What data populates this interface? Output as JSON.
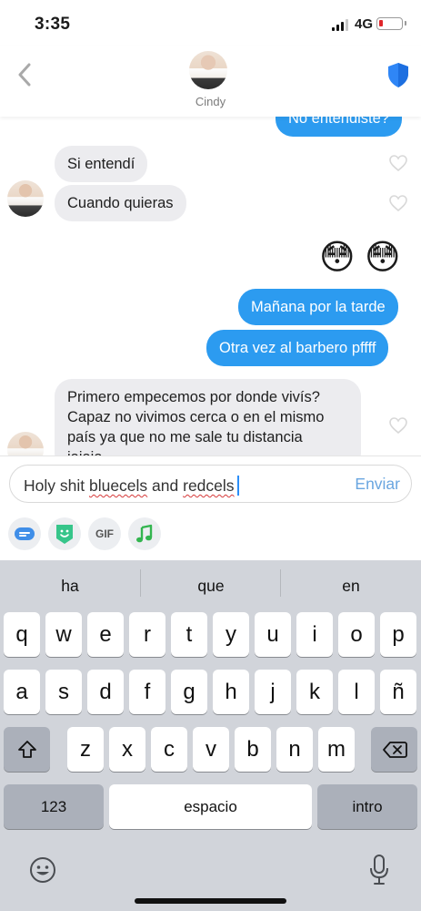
{
  "status": {
    "time": "3:35",
    "network": "4G"
  },
  "header": {
    "contact_name": "Cindy"
  },
  "messages": {
    "out_top_partial": "No entendiste?",
    "in_1": "Si entendí",
    "in_2": "Cuando quieras",
    "emoji_1": "😳",
    "emoji_2": "😳",
    "out_1": "Mañana por la tarde",
    "out_2": "Otra vez al barbero pffff",
    "in_3_line1": "Primero empecemos por donde vivís?",
    "in_3_line2": "Capaz no vivimos cerca o en el mismo",
    "in_3_line3": "país ya que no me sale tu distancia",
    "in_3_line4": "jajaja"
  },
  "composer": {
    "text_1": "Holy shit ",
    "text_2": "bluecels",
    "text_3": " and ",
    "text_4": "redcels",
    "send_label": "Enviar",
    "gif_label": "GIF"
  },
  "keyboard": {
    "suggestions": [
      "ha",
      "que",
      "en"
    ],
    "row1": [
      "q",
      "w",
      "e",
      "r",
      "t",
      "y",
      "u",
      "i",
      "o",
      "p"
    ],
    "row2": [
      "a",
      "s",
      "d",
      "f",
      "g",
      "h",
      "j",
      "k",
      "l",
      "ñ"
    ],
    "row3": [
      "z",
      "x",
      "c",
      "v",
      "b",
      "n",
      "m"
    ],
    "numbers_label": "123",
    "space_label": "espacio",
    "return_label": "intro"
  },
  "colors": {
    "accent_blue": "#2c9bf0",
    "shield_blue": "#2f86f6",
    "battery_red": "#e0262a"
  }
}
